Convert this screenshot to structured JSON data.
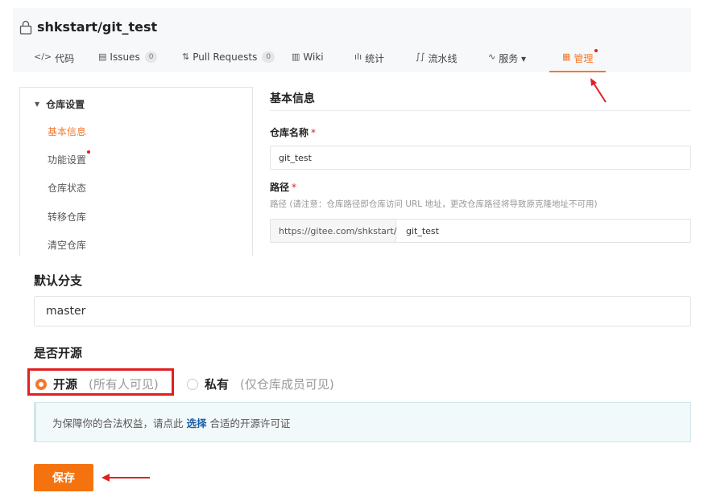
{
  "repo": {
    "name": "shkstart/git_test",
    "icon": "lock-icon"
  },
  "tabs": [
    {
      "glyph": "</>",
      "label": "代码"
    },
    {
      "glyph": "▤",
      "label": "Issues",
      "count": "0"
    },
    {
      "glyph": "⇅",
      "label": "Pull Requests",
      "count": "0"
    },
    {
      "glyph": "▥",
      "label": "Wiki"
    },
    {
      "glyph": "ılı",
      "label": "统计"
    },
    {
      "glyph": "∫∫",
      "label": "流水线"
    },
    {
      "glyph": "∿",
      "label": "服务 ▾"
    },
    {
      "glyph": "▦",
      "label": "管理"
    }
  ],
  "sidebar": {
    "group": "仓库设置",
    "items": [
      {
        "label": "基本信息"
      },
      {
        "label": "功能设置"
      },
      {
        "label": "仓库状态"
      },
      {
        "label": "转移仓库"
      },
      {
        "label": "清空仓库"
      }
    ]
  },
  "panel": {
    "title": "基本信息",
    "repo_name_label": "仓库名称",
    "repo_name_value": "git_test",
    "path_label": "路径",
    "path_hint": "路径 (请注意：仓库路径即仓库访问 URL 地址，更改仓库路径将导致原克隆地址不可用)",
    "path_prefix": "https://gitee.com/shkstart/",
    "path_value": "git_test",
    "required_mark": "*"
  },
  "default_branch": {
    "label": "默认分支",
    "value": "master"
  },
  "open_source": {
    "label": "是否开源",
    "public_main": "开源",
    "public_sub": "(所有人可见)",
    "private_main": "私有",
    "private_sub": "(仅仓库成员可见)",
    "selected": "public"
  },
  "notice": {
    "before": "为保障你的合法权益，请点此",
    "link": "选择",
    "after": "合适的开源许可证"
  },
  "save_label": "保存",
  "colors": {
    "accent": "#f5772c",
    "annotation": "#e02020",
    "link": "#1a5fa8"
  }
}
